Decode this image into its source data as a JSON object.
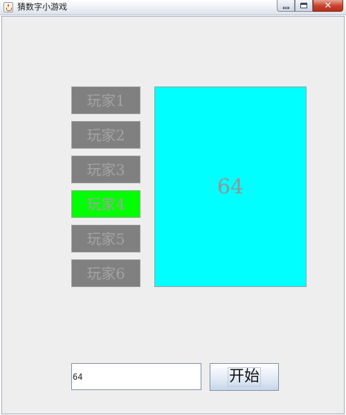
{
  "window": {
    "title": "猜数字小游戏",
    "app_icon": "java-cup-icon",
    "controls": [
      "minimize-icon",
      "maximize-icon",
      "close-icon"
    ],
    "close_glyph": "✕"
  },
  "players": [
    {
      "label": "玩家1",
      "active": false
    },
    {
      "label": "玩家2",
      "active": false
    },
    {
      "label": "玩家3",
      "active": false
    },
    {
      "label": "玩家4",
      "active": true
    },
    {
      "label": "玩家5",
      "active": false
    },
    {
      "label": "玩家6",
      "active": false
    }
  ],
  "display": {
    "number": "64",
    "background": "#00ffff"
  },
  "colors": {
    "player_inactive": "#808080",
    "player_active": "#00ff00",
    "player_text": "#a3a3a3"
  },
  "input": {
    "value": "64"
  },
  "start_button": {
    "label": "开始"
  }
}
